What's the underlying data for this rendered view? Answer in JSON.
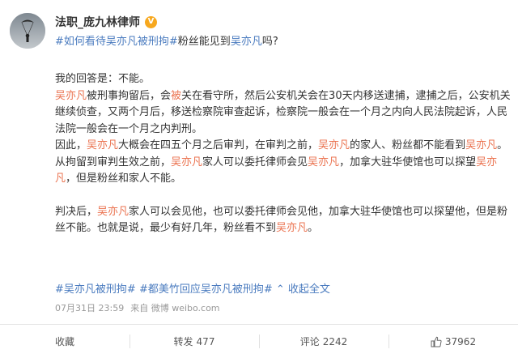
{
  "post": {
    "author": "法职_庞九林律师",
    "verified_badge": "V",
    "topic_line": {
      "hashtag1": "#如何看待吴亦凡被刑拘#",
      "text1": "粉丝能见到",
      "name": "吴亦凡",
      "text2": "吗?"
    }
  },
  "content": {
    "intro": "我的回答是：不能。",
    "p1": {
      "a_hl": "吴亦凡",
      "b": "被刑事拘留后，会",
      "c_hl": "被",
      "d": "关在看守所，然后公安机关会在30天内移送逮捕，逮捕之后，公安机关继续侦查，又两个月后，移送检察院审查起诉，检察院一般会在一个月之内向人民法院起诉，人民法院一般会在一个月之内判刑。"
    },
    "p2": {
      "a": "因此，",
      "b_hl": "吴亦凡",
      "c": "大概会在四五个月之后审判，在审判之前，",
      "d_hl": "吴亦凡",
      "e": "的家人、粉丝都不能看到",
      "f_hl": "吴亦凡",
      "g": "。"
    },
    "p3": {
      "a": "从拘留到审判生效之前，",
      "b_hl": "吴亦凡",
      "c": "家人可以委托律师会见",
      "d_hl": "吴亦凡",
      "e": "，加拿大驻华使馆也可以探望",
      "f_hl": "吴亦凡",
      "g": "，但是粉丝和家人不能。"
    },
    "p4": {
      "a": "判决后，",
      "b_hl": "吴亦凡",
      "c": "家人可以会见他，也可以委托律师会见他，加拿大驻华使馆也可以探望他，但是粉丝不能。也就是说，最少有好几年，粉丝看不到",
      "d_hl": "吴亦凡",
      "e": "。"
    },
    "tags": {
      "t1": "#吴亦凡被刑拘#",
      "t2": "#都美竹回应吴亦凡被刑拘#",
      "collapse": "收起全文",
      "collapse_arrow": "⌃"
    }
  },
  "meta": {
    "time": "07月31日 23:59",
    "source": "来自 微博 weibo.com"
  },
  "actions": {
    "collect": "收藏",
    "repost_label": "转发",
    "repost_count": "477",
    "comment_label": "评论",
    "comment_count": "2242",
    "like_count": "37962"
  },
  "colors": {
    "highlight": "#eb7350",
    "link": "#4a7bbf",
    "verified": "#f7a81e"
  }
}
